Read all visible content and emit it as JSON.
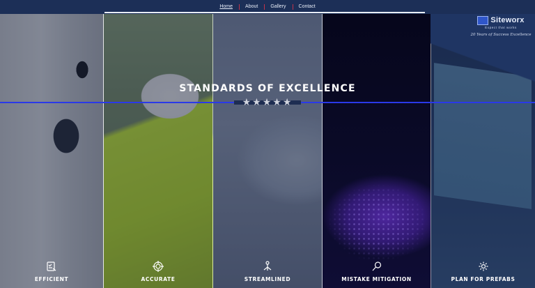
{
  "nav": {
    "items": [
      {
        "label": "Home",
        "active": true
      },
      {
        "label": "About",
        "active": false
      },
      {
        "label": "Gallery",
        "active": false
      },
      {
        "label": "Contact",
        "active": false
      }
    ]
  },
  "brand": {
    "name": "Siteworx",
    "tagline": "Expect that works",
    "subtitle": "20 Years of Success Excellence"
  },
  "hero": {
    "title": "STANDARDS OF EXCELLENCE",
    "stars": "★★★★★"
  },
  "features": [
    {
      "label": "EFFICIENT",
      "icon": "checklist-icon"
    },
    {
      "label": "ACCURATE",
      "icon": "target-icon"
    },
    {
      "label": "STREAMLINED",
      "icon": "flow-icon"
    },
    {
      "label": "MISTAKE MITIGATION",
      "icon": "magnifier-icon"
    },
    {
      "label": "PLAN FOR PREFABS",
      "icon": "gear-icon"
    }
  ],
  "colors": {
    "nav_bg": "#1c2f57",
    "accent_line": "#2a39e8",
    "nav_divider": "#c2334a"
  }
}
